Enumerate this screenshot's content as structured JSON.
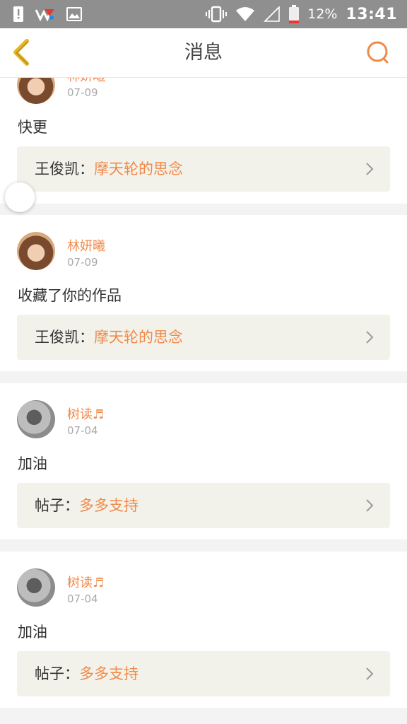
{
  "status_bar": {
    "battery_percent": "12%",
    "time": "13:41",
    "left_icons": [
      "alert-icon",
      "app-notification-icon",
      "image-icon"
    ],
    "right_icons": [
      "vibrate-icon",
      "wifi-icon",
      "signal-icon",
      "battery-icon"
    ]
  },
  "header": {
    "title": "消息",
    "back_icon": "back-chevron-icon",
    "search_icon": "search-icon"
  },
  "colors": {
    "accent": "#f08a4b",
    "back_icon": "#e8b51e",
    "card_bg": "#ffffff",
    "ref_bg": "#f3f2ea",
    "page_bg": "#f3f3f3",
    "status_bar_bg": "#8f8f8f"
  },
  "messages": [
    {
      "user": "林妍曦",
      "date": "07-09",
      "text": "快更",
      "ref_prefix": "王俊凯：",
      "ref_title": "摩天轮的思念",
      "avatar": "avatar-girl"
    },
    {
      "user": "林妍曦",
      "date": "07-09",
      "text": "收藏了你的作品",
      "ref_prefix": "王俊凯：",
      "ref_title": "摩天轮的思念",
      "avatar": "avatar-girl"
    },
    {
      "user": "树读♬",
      "date": "07-04",
      "text": "加油",
      "ref_prefix": "帖子：",
      "ref_title": "多多支持",
      "avatar": "avatar-boy"
    },
    {
      "user": "树读♬",
      "date": "07-04",
      "text": "加油",
      "ref_prefix": "帖子：",
      "ref_title": "多多支持",
      "avatar": "avatar-boy"
    }
  ]
}
